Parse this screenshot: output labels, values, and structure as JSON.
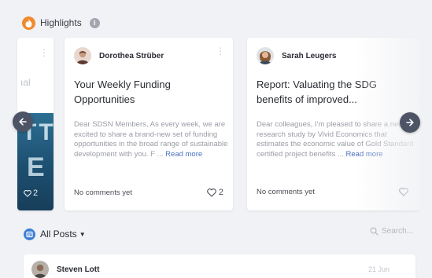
{
  "highlights": {
    "title": "Highlights"
  },
  "carousel": {
    "peek_card": {
      "partial_text": "ıal",
      "likes": "2"
    },
    "cards": [
      {
        "author": "Dorothea Strüber",
        "title": "Your Weekly Funding Opportunities",
        "excerpt": "Dear SDSN Members, As every week, we are excited to share a brand-new set of funding opportunities in the broad range of sustainable development with you. F ...",
        "read_more": "Read more",
        "comments": "No comments yet",
        "likes": "2"
      },
      {
        "author": "Sarah Leugers",
        "title": "Report: Valuating the SDG benefits of improved...",
        "excerpt": "Dear colleagues, I'm pleased to share a new research study by Vivid Economics that estimates the economic value of Gold Standard certified project benefits ...",
        "read_more": "Read more",
        "comments": "No comments yet",
        "likes": ""
      }
    ]
  },
  "posts": {
    "title": "All Posts",
    "search_placeholder": "Search...",
    "rows": [
      {
        "author": "Steven Lott",
        "date": "21 Jun"
      }
    ]
  },
  "colors": {
    "highlight_badge": "#f08a2e",
    "posts_badge": "#3e7fd6",
    "nav_button": "#4d5466",
    "read_more": "#4a6fc0",
    "background": "#f1f2f5"
  },
  "icons": {
    "highlight_badge": "flame-icon",
    "info": "info-icon",
    "prev": "arrow-left-icon",
    "next": "arrow-right-icon",
    "like": "heart-icon",
    "menu": "more-vertical-icon",
    "posts_badge": "posts-icon",
    "search": "search-icon"
  }
}
